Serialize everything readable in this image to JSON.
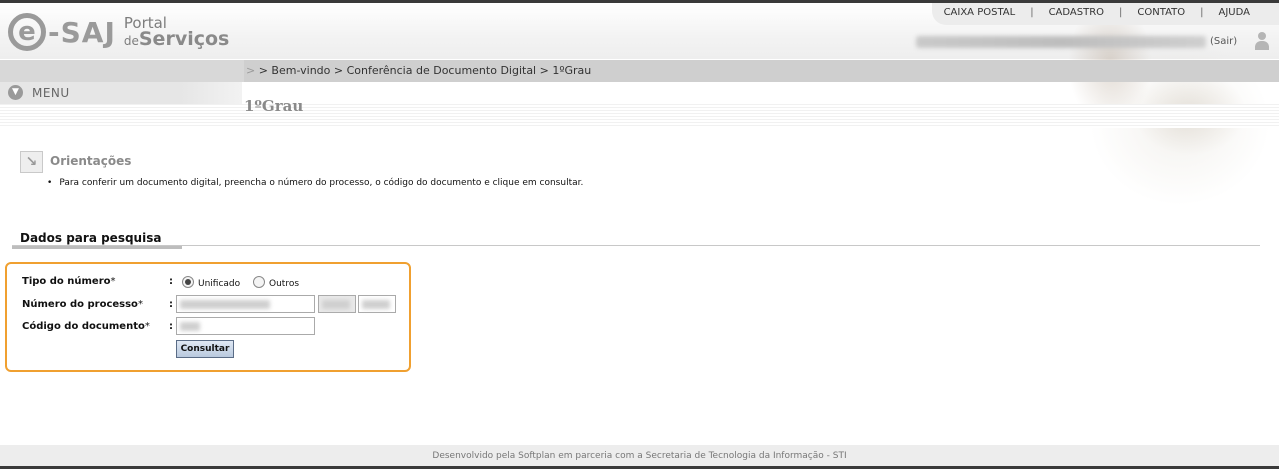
{
  "brand": {
    "logo_e": "e",
    "logo_saj": "-SAJ",
    "portal_line1": "Portal",
    "portal_de": "de",
    "portal_servicos": "Serviços"
  },
  "topnav": {
    "items": [
      "CAIXA POSTAL",
      "CADASTRO",
      "CONTATO",
      "AJUDA"
    ],
    "separator": "|"
  },
  "user": {
    "logout_label": "(Sair)",
    "icon": "user-icon"
  },
  "breadcrumb": {
    "prefix": ">",
    "text": "> Bem-vindo > Conferência de Documento Digital > 1ºGrau"
  },
  "menu": {
    "label": "MENU",
    "icon": "chevron-down-icon"
  },
  "page": {
    "title": "1ºGrau"
  },
  "orientacoes": {
    "title": "Orientações",
    "icon": "arrow-down-right-icon",
    "text": "Para conferir um documento digital, preencha o número do processo, o código do documento e clique em consultar.",
    "bullet": "•"
  },
  "form": {
    "section_title": "Dados para pesquisa",
    "colon": ":",
    "required_mark": "*",
    "tipo_label": "Tipo do número",
    "tipo_options": [
      {
        "label": "Unificado",
        "checked": true
      },
      {
        "label": "Outros",
        "checked": false
      }
    ],
    "processo_label": "Número do processo",
    "documento_label": "Código do documento",
    "submit_label": "Consultar"
  },
  "footer": {
    "text": "Desenvolvido pela Softplan em parceria com a Secretaria de Tecnologia da Informação - STI"
  },
  "colors": {
    "accent_border": "#f0a030",
    "button_border": "#5a6c86",
    "topbar": "#3a3a3a"
  }
}
